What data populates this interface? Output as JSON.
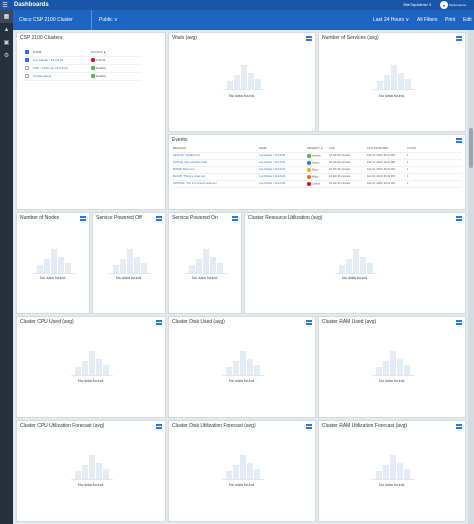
{
  "topbar": {
    "menu_icon": "hamburger-icon",
    "title": "Dashboards",
    "user": "SiteTopAdmin ∨",
    "brand_text": "Performance"
  },
  "sidebar": {
    "items": [
      "grid-icon",
      "alert-icon",
      "device-icon",
      "settings-icon"
    ]
  },
  "subbar": {
    "dashboard_name": "Cisco CSP 2100 Cluster",
    "visibility": "Public ∨",
    "time_range": "Last 24 Hours ∨",
    "filters": "All Filters",
    "print": "Print",
    "edit": "Edit"
  },
  "no_data": "No data found.",
  "clusters": {
    "title": "CSP 2100 Clusters",
    "col_name": "NAME",
    "col_status": "STATUS ▲",
    "rows": [
      {
        "name": "Lsp-Cluster / 10.2.8.22",
        "status": "Critical",
        "color": "#d0021b",
        "checked": true
      },
      {
        "name": "CSP - 2100 Lsp-10.2.8.33",
        "status": "Healthy",
        "color": "#4caf50",
        "checked": false
      },
      {
        "name": "Cluster Name",
        "status": "Healthy",
        "color": "#4caf50",
        "checked": false
      }
    ]
  },
  "vitals": {
    "title": "Vitals (avg)"
  },
  "services": {
    "title": "Number of Services (avg)"
  },
  "events": {
    "title": "Events",
    "headers": [
      "MESSAGE",
      "NAME",
      "SEVERITY ▲",
      "AGE",
      "LAST DETECTED",
      "COUNT"
    ],
    "rows": [
      {
        "message": "HEALTHY: Healthy text",
        "name": "Lsp-Cluster / 10.2.8.22",
        "severity": "Healthy",
        "color": "#4caf50",
        "age": "4d 14h 36 minutes",
        "last": "Feb 12, 2020, 06:21 PM",
        "count": "1"
      },
      {
        "message": "NOTICE: This is Notice mode",
        "name": "Lsp-Cluster / 10.2.8.22",
        "severity": "Notice",
        "color": "#2a78d6",
        "age": "4d 14h 36 minutes",
        "last": "Feb 12, 2020, 06:21 PM",
        "count": "1"
      },
      {
        "message": "MINOR: Minor text",
        "name": "Lsp-Cluster / 10.2.8.22",
        "severity": "Minor",
        "color": "#f5a623",
        "age": "4d 14h 36 minutes",
        "last": "Feb 12, 2020, 06:21 PM",
        "count": "1"
      },
      {
        "message": "MAJOR: This is a major text",
        "name": "Lsp-Cluster / 10.2.8.22",
        "severity": "Major",
        "color": "#f26b1d",
        "age": "4d 14h 36 minutes",
        "last": "Feb 12, 2020, 06:21 PM",
        "count": "1"
      },
      {
        "message": "CRITICAL: This is a Critical mode text",
        "name": "Lsp-Cluster / 10.2.8.22",
        "severity": "Critical",
        "color": "#d0021b",
        "age": "4d 14h 36 minutes",
        "last": "Feb 12, 2020, 06:21 PM",
        "count": "1"
      }
    ]
  },
  "row2": [
    "Number of Nodes",
    "Service Powered Off",
    "Service Powered On",
    "Cluster Resource Utilization (avg)"
  ],
  "row3": [
    "Cluster CPU Used (avg)",
    "Cluster Disk Used (avg)",
    "Cluster RAM Used (avg)"
  ],
  "row4": [
    "Cluster CPU Utilization Forecast (avg)",
    "Cluster Disk Utilization Forecast (avg)",
    "Cluster RAM Utilization Forecast (avg)"
  ]
}
